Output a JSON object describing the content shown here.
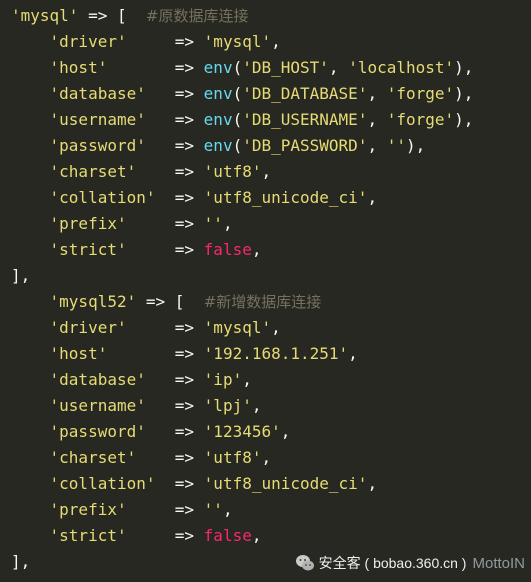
{
  "code": {
    "block1": {
      "open_key": "'mysql'",
      "arrow": "=>",
      "bracket_open": "[",
      "comment": "#原数据库连接",
      "rows": [
        {
          "key": "'driver'",
          "pad": "   ",
          "value": "'mysql'",
          "kind": "str"
        },
        {
          "key": "'host'",
          "pad": "     ",
          "fn": "env",
          "args": [
            "'DB_HOST'",
            "'localhost'"
          ]
        },
        {
          "key": "'database'",
          "pad": " ",
          "fn": "env",
          "args": [
            "'DB_DATABASE'",
            "'forge'"
          ]
        },
        {
          "key": "'username'",
          "pad": " ",
          "fn": "env",
          "args": [
            "'DB_USERNAME'",
            "'forge'"
          ]
        },
        {
          "key": "'password'",
          "pad": " ",
          "fn": "env",
          "args": [
            "'DB_PASSWORD'",
            "''"
          ]
        },
        {
          "key": "'charset'",
          "pad": "  ",
          "value": "'utf8'",
          "kind": "str"
        },
        {
          "key": "'collation'",
          "pad": "",
          "value": "'utf8_unicode_ci'",
          "kind": "str"
        },
        {
          "key": "'prefix'",
          "pad": "   ",
          "value": "''",
          "kind": "str"
        },
        {
          "key": "'strict'",
          "pad": "   ",
          "value": "false",
          "kind": "kw"
        }
      ],
      "close": "],"
    },
    "block2": {
      "open_key": "'mysql52'",
      "arrow": "=>",
      "bracket_open": "[",
      "comment": "#新增数据库连接",
      "rows": [
        {
          "key": "'driver'",
          "pad": "   ",
          "value": "'mysql'",
          "kind": "str"
        },
        {
          "key": "'host'",
          "pad": "     ",
          "value": "'192.168.1.251'",
          "kind": "str"
        },
        {
          "key": "'database'",
          "pad": " ",
          "value": "'ip'",
          "kind": "str"
        },
        {
          "key": "'username'",
          "pad": " ",
          "value": "'lpj'",
          "kind": "str"
        },
        {
          "key": "'password'",
          "pad": " ",
          "value": "'123456'",
          "kind": "str"
        },
        {
          "key": "'charset'",
          "pad": "  ",
          "value": "'utf8'",
          "kind": "str"
        },
        {
          "key": "'collation'",
          "pad": "",
          "value": "'utf8_unicode_ci'",
          "kind": "str"
        },
        {
          "key": "'prefix'",
          "pad": "   ",
          "value": "''",
          "kind": "str"
        },
        {
          "key": "'strict'",
          "pad": "   ",
          "value": "false",
          "kind": "kw"
        }
      ],
      "close": "],"
    }
  },
  "watermark": {
    "text": "安全客 ( bobao.360.cn )",
    "brand": "MottoIN",
    "icon": "wechat-icon"
  },
  "colors": {
    "background": "#272822",
    "string": "#e6db74",
    "function": "#66d9ef",
    "keyword": "#f92672",
    "comment": "#75715e",
    "plain": "#f8f8f2"
  }
}
